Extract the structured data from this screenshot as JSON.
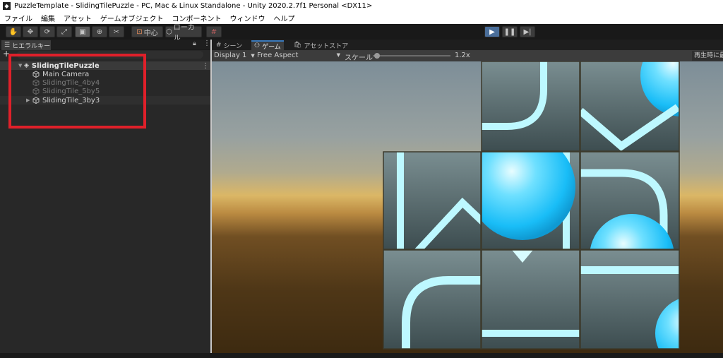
{
  "window": {
    "title": "PuzzleTemplate - SlidingTilePuzzle - PC, Mac & Linux Standalone - Unity 2020.2.7f1 Personal <DX11>"
  },
  "menu": [
    "ファイル",
    "編集",
    "アセット",
    "ゲームオブジェクト",
    "コンポーネント",
    "ウィンドウ",
    "ヘルプ"
  ],
  "toolbar": {
    "pivot_label": "中心",
    "space_label": "ローカル",
    "play_active": true
  },
  "hierarchy": {
    "tab_label": "ヒエラルキー",
    "scene_name": "SlidingTilePuzzle",
    "items": [
      {
        "name": "Main Camera",
        "active": true,
        "has_children": false
      },
      {
        "name": "SlidingTile_4by4",
        "active": false,
        "has_children": false
      },
      {
        "name": "SlidingTile_5by5",
        "active": false,
        "has_children": false
      },
      {
        "name": "SlidingTile_3by3",
        "active": true,
        "has_children": true
      }
    ],
    "highlight_color": "#e0202a"
  },
  "game_view": {
    "tabs": [
      "シーン",
      "ゲーム",
      "アセットストア"
    ],
    "active_tab": "ゲーム",
    "display": "Display 1",
    "aspect": "Free Aspect",
    "scale_label": "スケール",
    "scale_value": "1.2x",
    "scale_fraction": 0.05,
    "maximize_label": "再生時に最"
  },
  "puzzle": {
    "grid": 3,
    "empty_cell": "top-left",
    "tile_color": "#55686a",
    "glow_color": "#bdf8ff",
    "ball_color": "#1ec3ff"
  }
}
